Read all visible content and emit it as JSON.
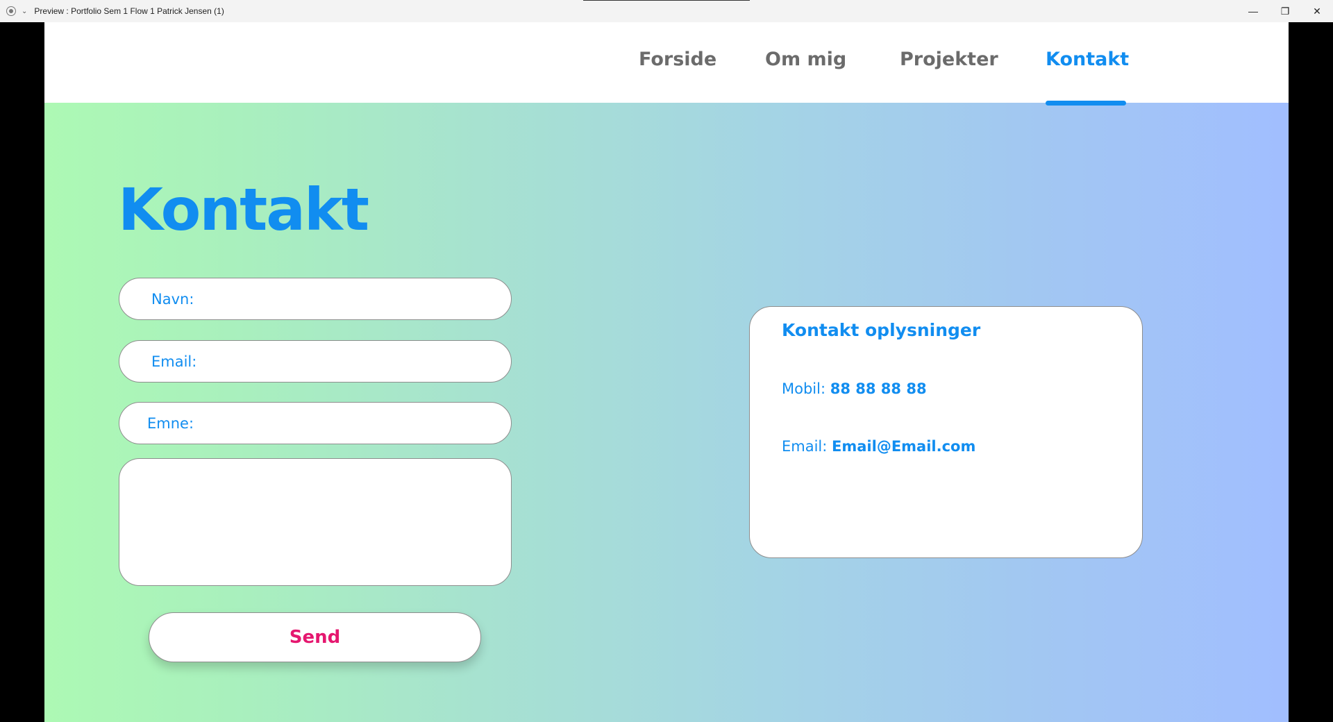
{
  "window": {
    "title": "Preview : Portfolio Sem 1 Flow 1 Patrick Jensen (1)",
    "controls": {
      "minimize": "—",
      "restore": "❐",
      "close": "✕"
    }
  },
  "nav": {
    "items": [
      {
        "label": "Forside",
        "active": false
      },
      {
        "label": "Om mig",
        "active": false
      },
      {
        "label": "Projekter",
        "active": false
      },
      {
        "label": "Kontakt",
        "active": true
      }
    ]
  },
  "page": {
    "heading": "Kontakt"
  },
  "form": {
    "name_label": "Navn:",
    "email_label": "Email:",
    "subject_label": "Emne:",
    "message_value": "",
    "send_label": "Send"
  },
  "contact_info": {
    "title": "Kontakt oplysninger",
    "mobile_label": "Mobil:",
    "mobile_value": "88 88 88 88",
    "email_label": "Email:",
    "email_value": "Email@Email.com"
  },
  "colors": {
    "accent": "#118df0",
    "send_text": "#e5176f",
    "nav_inactive": "#6b6b6b",
    "gradient_start": "#adf9b4",
    "gradient_end": "#a1beff"
  }
}
